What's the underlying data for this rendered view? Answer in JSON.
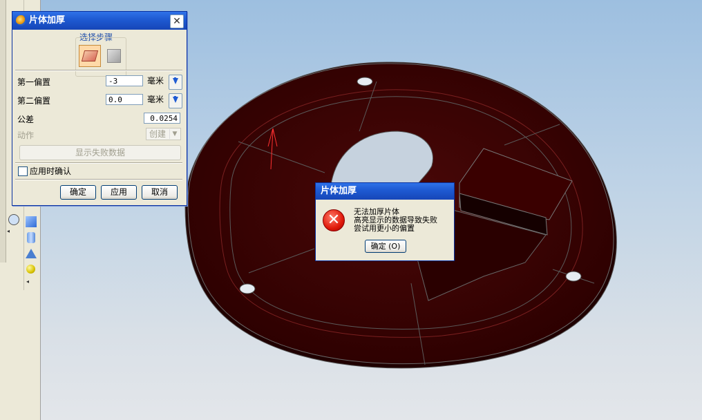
{
  "thicken_dialog": {
    "title": "片体加厚",
    "group_label": "选择步骤",
    "first_offset": {
      "label": "第一偏置",
      "value": "-3",
      "unit": "毫米"
    },
    "second_offset": {
      "label": "第二偏置",
      "value": "0.0",
      "unit": "毫米"
    },
    "tolerance": {
      "label": "公差",
      "value": "0.0254"
    },
    "action": {
      "label": "动作",
      "selected": "创建"
    },
    "show_failure_button": "显示失败数据",
    "confirm_on_apply": {
      "label": "应用时确认",
      "checked": false
    },
    "buttons": {
      "ok": "确定",
      "apply": "应用",
      "cancel": "取消"
    }
  },
  "error_dialog": {
    "title": "片体加厚",
    "lines": [
      "无法加厚片体",
      "高亮显示的数据导致失败",
      "尝试用更小的偏置"
    ],
    "ok_button": "确定 (O)"
  },
  "colors": {
    "part": "#3a0000",
    "title_bar": "#1f5bd3",
    "dialog_bg": "#ece9d8"
  },
  "icons": [
    "app-icon",
    "close-icon",
    "sheet-face-icon",
    "solid-body-icon",
    "error-icon",
    "cube-icon",
    "cylinder-icon",
    "cone-icon",
    "sphere-icon",
    "down-arrow-icon"
  ]
}
